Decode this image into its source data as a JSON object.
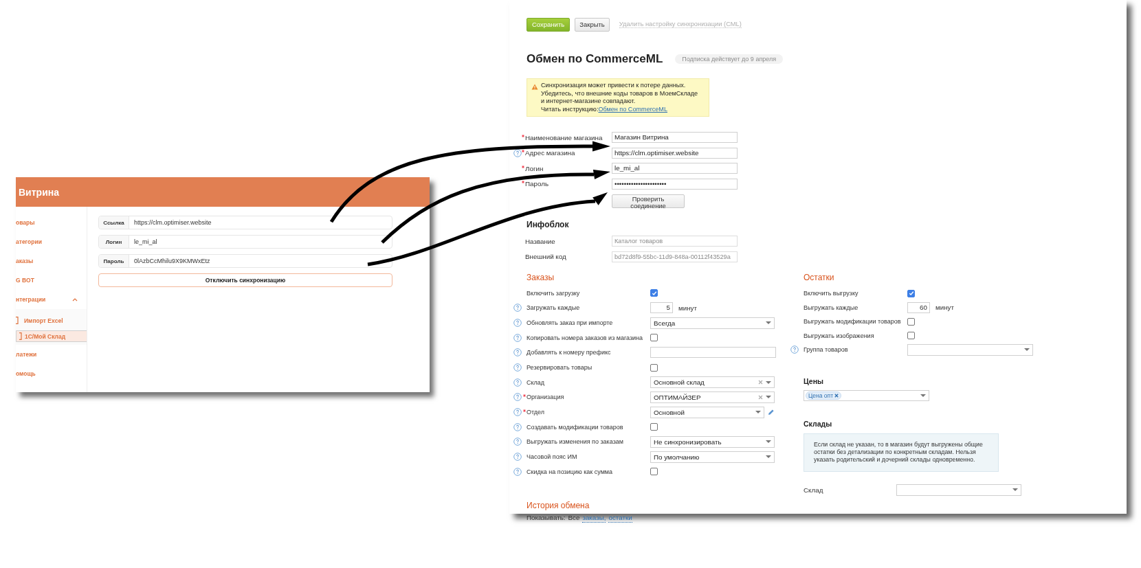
{
  "vitrina_app": {
    "title": "Витрина",
    "sidebar": {
      "items": [
        {
          "kind": "link",
          "label": "овары",
          "selected": false
        },
        {
          "kind": "link",
          "label": "атегории",
          "selected": false
        },
        {
          "kind": "link",
          "label": "аказы",
          "selected": false
        },
        {
          "kind": "link",
          "label": "G BOT",
          "selected": false
        },
        {
          "kind": "group",
          "label": "нтеграции",
          "selected": false,
          "expanded": true,
          "children": [
            {
              "label": "Импорт Excel",
              "selected": false
            },
            {
              "label": "1С/Мой Склад",
              "selected": true
            }
          ]
        },
        {
          "kind": "link",
          "label": "латежи",
          "selected": false
        },
        {
          "kind": "link",
          "label": "омощь",
          "selected": false
        }
      ]
    },
    "fields": [
      {
        "label": "Ссылка",
        "value": "https://clm.optimiser.website"
      },
      {
        "label": "Логин",
        "value": "le_mi_al"
      },
      {
        "label": "Пароль",
        "value": "0lAzbCcMhilu9X9KMWxEtz"
      }
    ],
    "disconnect_button": "Отключить синхронизацию"
  },
  "moysklad": {
    "toolbar": {
      "save": "Сохранить",
      "close": "Закрыть",
      "delete_link": "Удалить настройку синхронизации (CML)"
    },
    "title": "Обмен по CommerceML",
    "subscription": "Подписка действует до 9 апреля",
    "warning": {
      "lines": [
        "Синхронизация может привести к потере данных.",
        "Убедитесь, что внешние коды товаров в МоемСкладе",
        "и интернет-магазине совпадают."
      ],
      "instruction_label": "Читать инструкцию:",
      "instruction_link": "Обмен по CommerceML"
    },
    "shop_fields": [
      {
        "label": "Наименование магазина",
        "required": true,
        "help": false,
        "value": "Магазин Витрина"
      },
      {
        "label": "Адрес магазина",
        "required": true,
        "help": true,
        "value": "https://clm.optimiser.website"
      },
      {
        "label": "Логин",
        "required": true,
        "help": false,
        "value": "le_mi_al"
      },
      {
        "label": "Пароль",
        "required": true,
        "help": false,
        "value": "••••••••••••••••••••••"
      }
    ],
    "check_button": "Проверить соединение",
    "infoblock": {
      "title": "Инфоблок",
      "fields": [
        {
          "label": "Название",
          "value": "Каталог товаров"
        },
        {
          "label": "Внешний код",
          "value": "bd72d8f9-55bc-11d9-848a-00112f43529a"
        }
      ]
    },
    "orders": {
      "title": "Заказы",
      "rows": [
        {
          "kind": "checkbox",
          "label": "Включить загрузку",
          "help": false,
          "required": false,
          "checked": true
        },
        {
          "kind": "number",
          "label": "Загружать каждые",
          "help": true,
          "required": false,
          "value": "5",
          "unit": "минут"
        },
        {
          "kind": "select",
          "label": "Обновлять заказ при импорте",
          "help": true,
          "required": false,
          "value": "Всегда",
          "clearable": false,
          "editable": false
        },
        {
          "kind": "checkbox",
          "label": "Копировать номера заказов из магазина",
          "help": true,
          "required": false,
          "checked": false
        },
        {
          "kind": "text",
          "label": "Добавлять к номеру префикс",
          "help": true,
          "required": false
        },
        {
          "kind": "checkbox",
          "label": "Резервировать товары",
          "help": true,
          "required": false,
          "checked": false
        },
        {
          "kind": "select",
          "label": "Склад",
          "help": true,
          "required": false,
          "value": "Основной склад",
          "clearable": true,
          "editable": false
        },
        {
          "kind": "select",
          "label": "Организация",
          "help": true,
          "required": true,
          "value": "ОПТИМАЙЗЕР",
          "clearable": true,
          "editable": false
        },
        {
          "kind": "select",
          "label": "Отдел",
          "help": true,
          "required": true,
          "value": "Основной",
          "clearable": false,
          "editable": true
        },
        {
          "kind": "checkbox",
          "label": "Создавать модификации товаров",
          "help": true,
          "required": false,
          "checked": false
        },
        {
          "kind": "select",
          "label": "Выгружать изменения по заказам",
          "help": true,
          "required": false,
          "value": "Не синхронизировать",
          "clearable": false,
          "editable": false
        },
        {
          "kind": "select",
          "label": "Часовой пояс ИМ",
          "help": true,
          "required": false,
          "value": "По умолчанию",
          "clearable": false,
          "editable": false
        },
        {
          "kind": "checkbox",
          "label": "Скидка на позицию как сумма",
          "help": true,
          "required": false,
          "checked": false
        }
      ]
    },
    "stock": {
      "title": "Остатки",
      "rows": [
        {
          "kind": "checkbox",
          "label": "Включить выгрузку",
          "help": false,
          "required": false,
          "checked": true
        },
        {
          "kind": "number",
          "label": "Выгружать каждые",
          "help": false,
          "required": false,
          "value": "60",
          "unit": "минут"
        },
        {
          "kind": "checkbox",
          "label": "Выгружать модификации товаров",
          "help": false,
          "required": false,
          "checked": false
        },
        {
          "kind": "checkbox",
          "label": "Выгружать изображения",
          "help": false,
          "required": false,
          "checked": false
        },
        {
          "kind": "select",
          "label": "Группа товаров",
          "help": true,
          "required": false,
          "clearable": false,
          "editable": false
        }
      ]
    },
    "prices": {
      "title": "Цены",
      "tags": [
        "Цена опт"
      ]
    },
    "warehouses": {
      "title": "Склады",
      "note": "Если склад не указан, то в магазин будут выгружены общие остатки без детализации по конкретным складам. Нельзя указать родительский и дочерний склады одновременно.",
      "field_label": "Склад"
    },
    "history": {
      "title": "История обмена",
      "filter_label": "Показывать:",
      "filters": [
        {
          "label": "Все",
          "selected": true
        },
        {
          "label": "заказы,",
          "selected": false
        },
        {
          "label": "остатки",
          "selected": false
        }
      ]
    }
  }
}
